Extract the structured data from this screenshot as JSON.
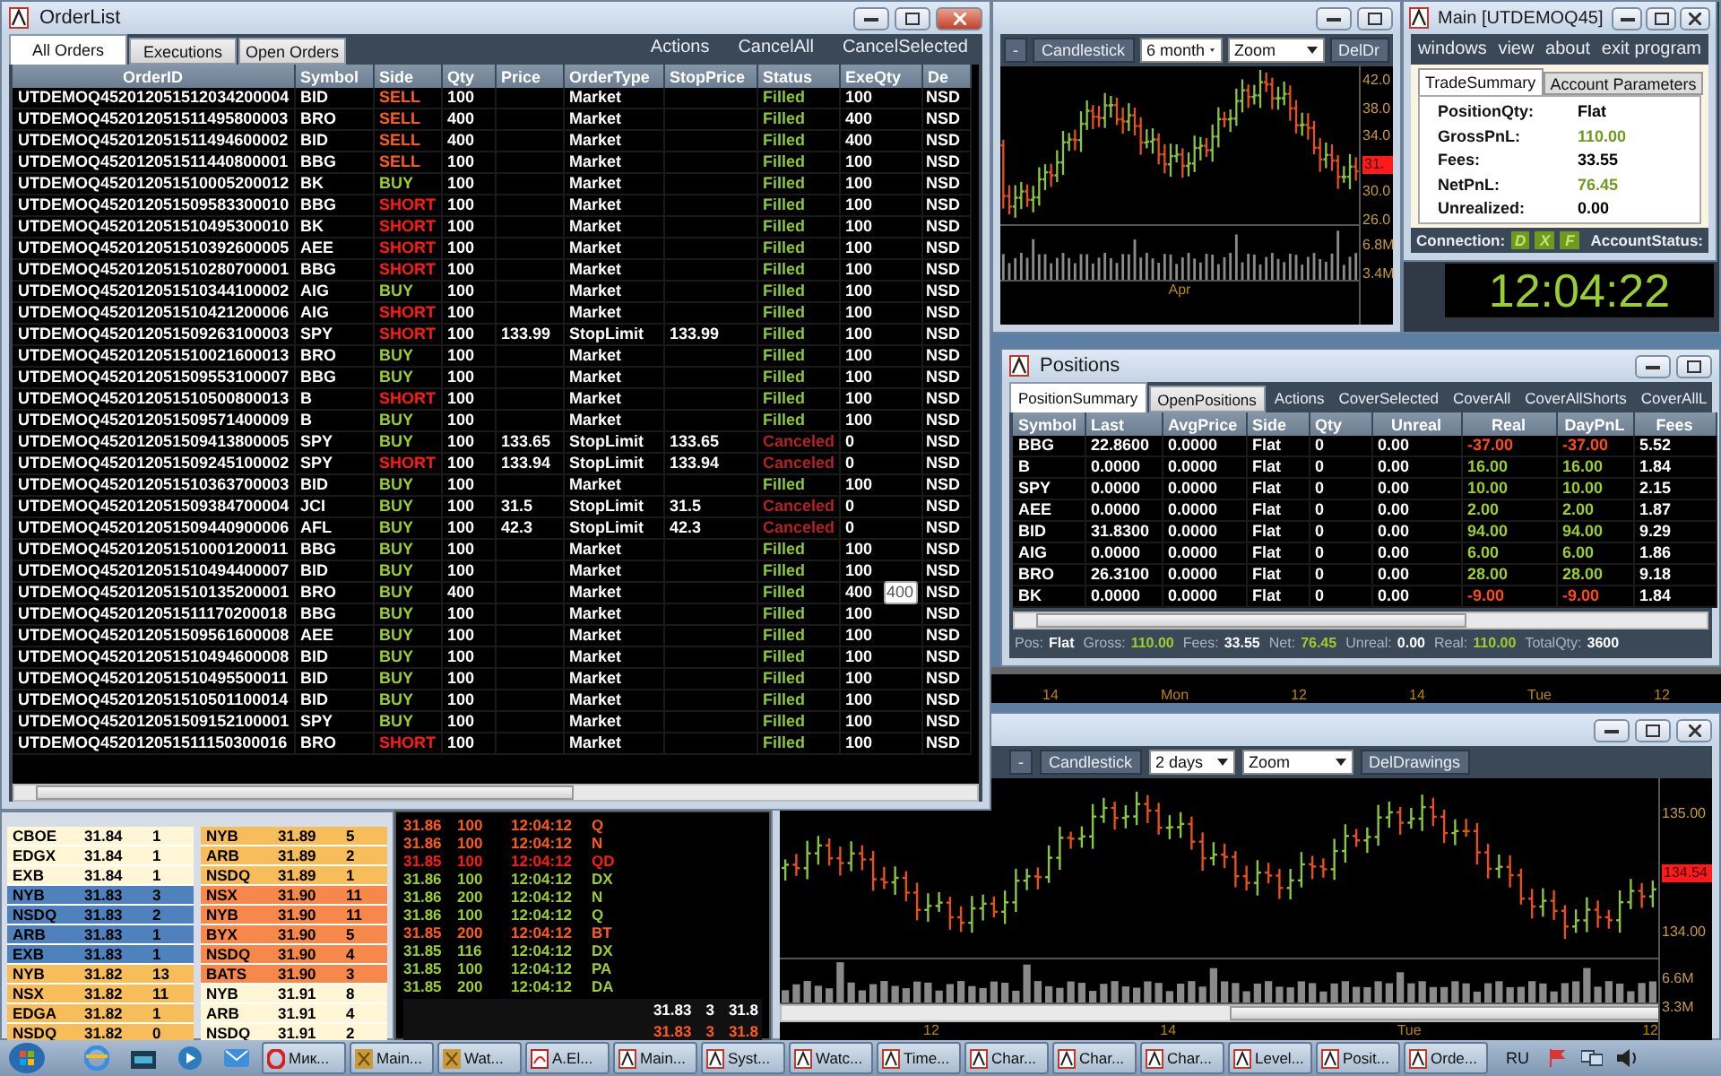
{
  "order_list": {
    "title": "OrderList",
    "tabs": [
      {
        "label": "All Orders",
        "selected": true
      },
      {
        "label": "Executions",
        "selected": false
      },
      {
        "label": "Open Orders",
        "selected": false
      }
    ],
    "actions": [
      "Actions",
      "CancelAll",
      "CancelSelected"
    ],
    "columns": [
      "OrderID",
      "Symbol",
      "Side",
      "Qty",
      "Price",
      "OrderType",
      "StopPrice",
      "Status",
      "ExeQty",
      "De"
    ],
    "rows": [
      {
        "id": "UTDEMOQ452012051512034200004",
        "symbol": "BID",
        "side": {
          "text": "SELL",
          "color": "#ff5a1e"
        },
        "qty": "100",
        "price": "",
        "type": "Market",
        "stop": "",
        "status": {
          "text": "Filled",
          "color": "#8cc63f"
        },
        "exe": "100",
        "dest": "NSD"
      },
      {
        "id": "UTDEMOQ452012051511495800003",
        "symbol": "BRO",
        "side": {
          "text": "SELL",
          "color": "#ff5a1e"
        },
        "qty": "400",
        "price": "",
        "type": "Market",
        "stop": "",
        "status": {
          "text": "Filled",
          "color": "#8cc63f"
        },
        "exe": "400",
        "dest": "NSD"
      },
      {
        "id": "UTDEMOQ452012051511494600002",
        "symbol": "BID",
        "side": {
          "text": "SELL",
          "color": "#ff5a1e"
        },
        "qty": "400",
        "price": "",
        "type": "Market",
        "stop": "",
        "status": {
          "text": "Filled",
          "color": "#8cc63f"
        },
        "exe": "400",
        "dest": "NSD"
      },
      {
        "id": "UTDEMOQ452012051511440800001",
        "symbol": "BBG",
        "side": {
          "text": "SELL",
          "color": "#ff5a1e"
        },
        "qty": "100",
        "price": "",
        "type": "Market",
        "stop": "",
        "status": {
          "text": "Filled",
          "color": "#8cc63f"
        },
        "exe": "100",
        "dest": "NSD"
      },
      {
        "id": "UTDEMOQ452012051510005200012",
        "symbol": "BK",
        "side": {
          "text": "BUY",
          "color": "#9acd32"
        },
        "qty": "100",
        "price": "",
        "type": "Market",
        "stop": "",
        "status": {
          "text": "Filled",
          "color": "#8cc63f"
        },
        "exe": "100",
        "dest": "NSD"
      },
      {
        "id": "UTDEMOQ452012051509583300010",
        "symbol": "BBG",
        "side": {
          "text": "SHORT",
          "color": "#ff1a1a"
        },
        "qty": "100",
        "price": "",
        "type": "Market",
        "stop": "",
        "status": {
          "text": "Filled",
          "color": "#8cc63f"
        },
        "exe": "100",
        "dest": "NSD"
      },
      {
        "id": "UTDEMOQ452012051510495300010",
        "symbol": "BK",
        "side": {
          "text": "SHORT",
          "color": "#ff1a1a"
        },
        "qty": "100",
        "price": "",
        "type": "Market",
        "stop": "",
        "status": {
          "text": "Filled",
          "color": "#8cc63f"
        },
        "exe": "100",
        "dest": "NSD"
      },
      {
        "id": "UTDEMOQ452012051510392600005",
        "symbol": "AEE",
        "side": {
          "text": "SHORT",
          "color": "#ff1a1a"
        },
        "qty": "100",
        "price": "",
        "type": "Market",
        "stop": "",
        "status": {
          "text": "Filled",
          "color": "#8cc63f"
        },
        "exe": "100",
        "dest": "NSD"
      },
      {
        "id": "UTDEMOQ452012051510280700001",
        "symbol": "BBG",
        "side": {
          "text": "SHORT",
          "color": "#ff1a1a"
        },
        "qty": "100",
        "price": "",
        "type": "Market",
        "stop": "",
        "status": {
          "text": "Filled",
          "color": "#8cc63f"
        },
        "exe": "100",
        "dest": "NSD"
      },
      {
        "id": "UTDEMOQ452012051510344100002",
        "symbol": "AIG",
        "side": {
          "text": "BUY",
          "color": "#9acd32"
        },
        "qty": "100",
        "price": "",
        "type": "Market",
        "stop": "",
        "status": {
          "text": "Filled",
          "color": "#8cc63f"
        },
        "exe": "100",
        "dest": "NSD"
      },
      {
        "id": "UTDEMOQ452012051510421200006",
        "symbol": "AIG",
        "side": {
          "text": "SHORT",
          "color": "#ff1a1a"
        },
        "qty": "100",
        "price": "",
        "type": "Market",
        "stop": "",
        "status": {
          "text": "Filled",
          "color": "#8cc63f"
        },
        "exe": "100",
        "dest": "NSD"
      },
      {
        "id": "UTDEMOQ452012051509263100003",
        "symbol": "SPY",
        "side": {
          "text": "SHORT",
          "color": "#ff1a1a"
        },
        "qty": "100",
        "price": "133.99",
        "type": "StopLimit",
        "stop": "133.99",
        "status": {
          "text": "Filled",
          "color": "#8cc63f"
        },
        "exe": "100",
        "dest": "NSD"
      },
      {
        "id": "UTDEMOQ452012051510021600013",
        "symbol": "BRO",
        "side": {
          "text": "BUY",
          "color": "#9acd32"
        },
        "qty": "100",
        "price": "",
        "type": "Market",
        "stop": "",
        "status": {
          "text": "Filled",
          "color": "#8cc63f"
        },
        "exe": "100",
        "dest": "NSD"
      },
      {
        "id": "UTDEMOQ452012051509553100007",
        "symbol": "BBG",
        "side": {
          "text": "BUY",
          "color": "#9acd32"
        },
        "qty": "100",
        "price": "",
        "type": "Market",
        "stop": "",
        "status": {
          "text": "Filled",
          "color": "#8cc63f"
        },
        "exe": "100",
        "dest": "NSD"
      },
      {
        "id": "UTDEMOQ452012051510500800013",
        "symbol": "B",
        "side": {
          "text": "SHORT",
          "color": "#ff1a1a"
        },
        "qty": "100",
        "price": "",
        "type": "Market",
        "stop": "",
        "status": {
          "text": "Filled",
          "color": "#8cc63f"
        },
        "exe": "100",
        "dest": "NSD"
      },
      {
        "id": "UTDEMOQ452012051509571400009",
        "symbol": "B",
        "side": {
          "text": "BUY",
          "color": "#9acd32"
        },
        "qty": "100",
        "price": "",
        "type": "Market",
        "stop": "",
        "status": {
          "text": "Filled",
          "color": "#8cc63f"
        },
        "exe": "100",
        "dest": "NSD"
      },
      {
        "id": "UTDEMOQ452012051509413800005",
        "symbol": "SPY",
        "side": {
          "text": "BUY",
          "color": "#9acd32"
        },
        "qty": "100",
        "price": "133.65",
        "type": "StopLimit",
        "stop": "133.65",
        "status": {
          "text": "Canceled",
          "color": "#b22222"
        },
        "exe": "0",
        "dest": "NSD"
      },
      {
        "id": "UTDEMOQ452012051509245100002",
        "symbol": "SPY",
        "side": {
          "text": "SHORT",
          "color": "#ff1a1a"
        },
        "qty": "100",
        "price": "133.94",
        "type": "StopLimit",
        "stop": "133.94",
        "status": {
          "text": "Canceled",
          "color": "#b22222"
        },
        "exe": "0",
        "dest": "NSD"
      },
      {
        "id": "UTDEMOQ452012051510363700003",
        "symbol": "BID",
        "side": {
          "text": "BUY",
          "color": "#9acd32"
        },
        "qty": "100",
        "price": "",
        "type": "Market",
        "stop": "",
        "status": {
          "text": "Filled",
          "color": "#8cc63f"
        },
        "exe": "100",
        "dest": "NSD"
      },
      {
        "id": "UTDEMOQ452012051509384700004",
        "symbol": "JCI",
        "side": {
          "text": "BUY",
          "color": "#9acd32"
        },
        "qty": "100",
        "price": "31.5",
        "type": "StopLimit",
        "stop": "31.5",
        "status": {
          "text": "Canceled",
          "color": "#b22222"
        },
        "exe": "0",
        "dest": "NSD"
      },
      {
        "id": "UTDEMOQ452012051509440900006",
        "symbol": "AFL",
        "side": {
          "text": "BUY",
          "color": "#9acd32"
        },
        "qty": "100",
        "price": "42.3",
        "type": "StopLimit",
        "stop": "42.3",
        "status": {
          "text": "Canceled",
          "color": "#b22222"
        },
        "exe": "0",
        "dest": "NSD"
      },
      {
        "id": "UTDEMOQ452012051510001200011",
        "symbol": "BBG",
        "side": {
          "text": "BUY",
          "color": "#9acd32"
        },
        "qty": "100",
        "price": "",
        "type": "Market",
        "stop": "",
        "status": {
          "text": "Filled",
          "color": "#8cc63f"
        },
        "exe": "100",
        "dest": "NSD"
      },
      {
        "id": "UTDEMOQ452012051510494400007",
        "symbol": "BID",
        "side": {
          "text": "BUY",
          "color": "#9acd32"
        },
        "qty": "100",
        "price": "",
        "type": "Market",
        "stop": "",
        "status": {
          "text": "Filled",
          "color": "#8cc63f"
        },
        "exe": "100",
        "dest": "NSD"
      },
      {
        "id": "UTDEMOQ452012051510135200001",
        "symbol": "BRO",
        "side": {
          "text": "BUY",
          "color": "#9acd32"
        },
        "qty": "400",
        "price": "",
        "type": "Market",
        "stop": "",
        "status": {
          "text": "Filled",
          "color": "#8cc63f"
        },
        "exe": "400",
        "dest": "NSD",
        "tooltip": "400"
      },
      {
        "id": "UTDEMOQ452012051511170200018",
        "symbol": "BBG",
        "side": {
          "text": "BUY",
          "color": "#9acd32"
        },
        "qty": "100",
        "price": "",
        "type": "Market",
        "stop": "",
        "status": {
          "text": "Filled",
          "color": "#8cc63f"
        },
        "exe": "100",
        "dest": "NSD"
      },
      {
        "id": "UTDEMOQ452012051509561600008",
        "symbol": "AEE",
        "side": {
          "text": "BUY",
          "color": "#9acd32"
        },
        "qty": "100",
        "price": "",
        "type": "Market",
        "stop": "",
        "status": {
          "text": "Filled",
          "color": "#8cc63f"
        },
        "exe": "100",
        "dest": "NSD"
      },
      {
        "id": "UTDEMOQ452012051510494600008",
        "symbol": "BID",
        "side": {
          "text": "BUY",
          "color": "#9acd32"
        },
        "qty": "100",
        "price": "",
        "type": "Market",
        "stop": "",
        "status": {
          "text": "Filled",
          "color": "#8cc63f"
        },
        "exe": "100",
        "dest": "NSD"
      },
      {
        "id": "UTDEMOQ452012051510495500011",
        "symbol": "BID",
        "side": {
          "text": "BUY",
          "color": "#9acd32"
        },
        "qty": "100",
        "price": "",
        "type": "Market",
        "stop": "",
        "status": {
          "text": "Filled",
          "color": "#8cc63f"
        },
        "exe": "100",
        "dest": "NSD"
      },
      {
        "id": "UTDEMOQ452012051510501100014",
        "symbol": "BID",
        "side": {
          "text": "BUY",
          "color": "#9acd32"
        },
        "qty": "100",
        "price": "",
        "type": "Market",
        "stop": "",
        "status": {
          "text": "Filled",
          "color": "#8cc63f"
        },
        "exe": "100",
        "dest": "NSD"
      },
      {
        "id": "UTDEMOQ452012051509152100001",
        "symbol": "SPY",
        "side": {
          "text": "BUY",
          "color": "#9acd32"
        },
        "qty": "100",
        "price": "",
        "type": "Market",
        "stop": "",
        "status": {
          "text": "Filled",
          "color": "#8cc63f"
        },
        "exe": "100",
        "dest": "NSD"
      },
      {
        "id": "UTDEMOQ452012051511150300016",
        "symbol": "BRO",
        "side": {
          "text": "SHORT",
          "color": "#ff1a1a"
        },
        "qty": "100",
        "price": "",
        "type": "Market",
        "stop": "",
        "status": {
          "text": "Filled",
          "color": "#8cc63f"
        },
        "exe": "100",
        "dest": "NSD"
      }
    ]
  },
  "chart_top": {
    "toolbar": {
      "buttons": [
        "-",
        "Candlestick"
      ],
      "period": "6 month",
      "zoom": "Zoom",
      "last_button": "DelDr"
    },
    "price_labels": [
      {
        "text": "42.0",
        "kind": "tick"
      },
      {
        "text": "38.0",
        "kind": "tick"
      },
      {
        "text": "34.0",
        "kind": "tick"
      },
      {
        "text": "31.",
        "kind": "last"
      },
      {
        "text": "30.0",
        "kind": "tick"
      },
      {
        "text": "26.0",
        "kind": "tick"
      }
    ],
    "volume_labels": [
      "6.8M",
      "3.4M"
    ],
    "time_labels": [
      "Apr"
    ]
  },
  "main": {
    "title": "Main [UTDEMOQ45]",
    "menu": [
      "windows",
      "view",
      "about",
      "exit program"
    ],
    "tabs": [
      {
        "label": "TradeSummary",
        "selected": true
      },
      {
        "label": "Account Parameters",
        "selected": false
      }
    ],
    "fields": [
      {
        "label": "PositionQty:",
        "value": "Flat",
        "color": "#000000"
      },
      {
        "label": "GrossPnL:",
        "value": "110.00",
        "color": "#6e9b1e"
      },
      {
        "label": "Fees:",
        "value": "33.55",
        "color": "#000000"
      },
      {
        "label": "NetPnL:",
        "value": "76.45",
        "color": "#6e9b1e"
      },
      {
        "label": "Unrealized:",
        "value": "0.00",
        "color": "#000000"
      }
    ],
    "connection_label": "Connection:",
    "connections": [
      "D",
      "X",
      "F"
    ],
    "account_status_label": "AccountStatus:"
  },
  "clock": "12:04:22",
  "positions": {
    "title": "Positions",
    "tabs": [
      {
        "label": "PositionSummary",
        "selected": true
      },
      {
        "label": "OpenPositions",
        "selected": false
      }
    ],
    "actions": [
      "Actions",
      "CoverSelected",
      "CoverAll",
      "CoverAllShorts",
      "CoverAllL"
    ],
    "columns": [
      "Symbol",
      "Last",
      "AvgPrice",
      "Side",
      "Qty",
      "Unreal",
      "Real",
      "DayPnL",
      "Fees"
    ],
    "rows": [
      {
        "symbol": "BBG",
        "last": "22.8600",
        "avg": "0.0000",
        "side": "Flat",
        "qty": "0",
        "unreal": "0.00",
        "real": "-37.00",
        "day": "-37.00",
        "fees": "5.52",
        "color": "#ff4a1a"
      },
      {
        "symbol": "B",
        "last": "0.0000",
        "avg": "0.0000",
        "side": "Flat",
        "qty": "0",
        "unreal": "0.00",
        "real": "16.00",
        "day": "16.00",
        "fees": "1.84",
        "color": "#9acd32"
      },
      {
        "symbol": "SPY",
        "last": "0.0000",
        "avg": "0.0000",
        "side": "Flat",
        "qty": "0",
        "unreal": "0.00",
        "real": "10.00",
        "day": "10.00",
        "fees": "2.15",
        "color": "#9acd32"
      },
      {
        "symbol": "AEE",
        "last": "0.0000",
        "avg": "0.0000",
        "side": "Flat",
        "qty": "0",
        "unreal": "0.00",
        "real": "2.00",
        "day": "2.00",
        "fees": "1.87",
        "color": "#9acd32"
      },
      {
        "symbol": "BID",
        "last": "31.8300",
        "avg": "0.0000",
        "side": "Flat",
        "qty": "0",
        "unreal": "0.00",
        "real": "94.00",
        "day": "94.00",
        "fees": "9.29",
        "color": "#9acd32"
      },
      {
        "symbol": "AIG",
        "last": "0.0000",
        "avg": "0.0000",
        "side": "Flat",
        "qty": "0",
        "unreal": "0.00",
        "real": "6.00",
        "day": "6.00",
        "fees": "1.86",
        "color": "#9acd32"
      },
      {
        "symbol": "BRO",
        "last": "26.3100",
        "avg": "0.0000",
        "side": "Flat",
        "qty": "0",
        "unreal": "0.00",
        "real": "28.00",
        "day": "28.00",
        "fees": "9.18",
        "color": "#9acd32"
      },
      {
        "symbol": "BK",
        "last": "0.0000",
        "avg": "0.0000",
        "side": "Flat",
        "qty": "0",
        "unreal": "0.00",
        "real": "-9.00",
        "day": "-9.00",
        "fees": "1.84",
        "color": "#ff4a1a"
      }
    ],
    "summary": [
      {
        "label": "Pos:",
        "value": "Flat",
        "color": "#ffffff"
      },
      {
        "label": "Gross:",
        "value": "110.00",
        "color": "#9acd32"
      },
      {
        "label": "Fees:",
        "value": "33.55",
        "color": "#ffffff"
      },
      {
        "label": "Net:",
        "value": "76.45",
        "color": "#9acd32"
      },
      {
        "label": "Unreal:",
        "value": "0.00",
        "color": "#ffffff"
      },
      {
        "label": "Real:",
        "value": "110.00",
        "color": "#9acd32"
      },
      {
        "label": "TotalQty:",
        "value": "3600",
        "color": "#ffffff"
      }
    ]
  },
  "time_strip": [
    "14",
    "Mon",
    "12",
    "14",
    "Tue",
    "12"
  ],
  "chart_bottom": {
    "toolbar": {
      "buttons": [
        "-",
        "Candlestick"
      ],
      "period": "2 days",
      "zoom": "Zoom",
      "last_button": "DelDrawings"
    },
    "price_labels": [
      {
        "text": "135.00",
        "kind": "tick"
      },
      {
        "text": "134.54",
        "kind": "last"
      },
      {
        "text": "134.00",
        "kind": "tick"
      }
    ],
    "volume_labels": [
      "6.6M",
      "3.3M"
    ],
    "time_labels": [
      "12",
      "14",
      "Tue",
      "12"
    ]
  },
  "level2": {
    "bids": [
      {
        "exchange": "CBOE",
        "price": "31.84",
        "size": "1",
        "color": "#fff6d5"
      },
      {
        "exchange": "EDGX",
        "price": "31.84",
        "size": "1",
        "color": "#fff6d5"
      },
      {
        "exchange": "EXB",
        "price": "31.84",
        "size": "1",
        "color": "#fff6d5"
      },
      {
        "exchange": "NYB",
        "price": "31.83",
        "size": "3",
        "color": "#4f81bd"
      },
      {
        "exchange": "NSDQ",
        "price": "31.83",
        "size": "2",
        "color": "#4f81bd"
      },
      {
        "exchange": "ARB",
        "price": "31.83",
        "size": "1",
        "color": "#4f81bd"
      },
      {
        "exchange": "EXB",
        "price": "31.83",
        "size": "1",
        "color": "#4f81bd"
      },
      {
        "exchange": "NYB",
        "price": "31.82",
        "size": "13",
        "color": "#f6bd5a"
      },
      {
        "exchange": "NSX",
        "price": "31.82",
        "size": "11",
        "color": "#f6bd5a"
      },
      {
        "exchange": "EDGA",
        "price": "31.82",
        "size": "1",
        "color": "#f6bd5a"
      },
      {
        "exchange": "NSDQ",
        "price": "31.82",
        "size": "0",
        "color": "#f6bd5a"
      }
    ],
    "asks": [
      {
        "exchange": "NYB",
        "price": "31.89",
        "size": "5",
        "color": "#f6bd5a"
      },
      {
        "exchange": "ARB",
        "price": "31.89",
        "size": "2",
        "color": "#f6bd5a"
      },
      {
        "exchange": "NSDQ",
        "price": "31.89",
        "size": "1",
        "color": "#f6bd5a"
      },
      {
        "exchange": "NSX",
        "price": "31.90",
        "size": "11",
        "color": "#f5884a"
      },
      {
        "exchange": "NYB",
        "price": "31.90",
        "size": "11",
        "color": "#f5884a"
      },
      {
        "exchange": "BYX",
        "price": "31.90",
        "size": "5",
        "color": "#f5884a"
      },
      {
        "exchange": "NSDQ",
        "price": "31.90",
        "size": "4",
        "color": "#f5884a"
      },
      {
        "exchange": "BATS",
        "price": "31.90",
        "size": "3",
        "color": "#f5884a"
      },
      {
        "exchange": "NYB",
        "price": "31.91",
        "size": "8",
        "color": "#fff6d5"
      },
      {
        "exchange": "ARB",
        "price": "31.91",
        "size": "4",
        "color": "#fff6d5"
      },
      {
        "exchange": "NSDQ",
        "price": "31.91",
        "size": "2",
        "color": "#fff6d5"
      }
    ]
  },
  "time_and_sales": {
    "trades": [
      {
        "price": "31.86",
        "size": "100",
        "time": "12:04:12",
        "exchange": "Q",
        "color": "#ff5a1e"
      },
      {
        "price": "31.86",
        "size": "100",
        "time": "12:04:12",
        "exchange": "N",
        "color": "#ff5a1e"
      },
      {
        "price": "31.85",
        "size": "100",
        "time": "12:04:12",
        "exchange": "QD",
        "color": "#ff1a1a"
      },
      {
        "price": "31.86",
        "size": "100",
        "time": "12:04:12",
        "exchange": "DX",
        "color": "#9acd32"
      },
      {
        "price": "31.86",
        "size": "200",
        "time": "12:04:12",
        "exchange": "N",
        "color": "#9acd32"
      },
      {
        "price": "31.86",
        "size": "100",
        "time": "12:04:12",
        "exchange": "Q",
        "color": "#9acd32"
      },
      {
        "price": "31.85",
        "size": "200",
        "time": "12:04:12",
        "exchange": "BT",
        "color": "#ff5a1e"
      },
      {
        "price": "31.85",
        "size": "116",
        "time": "12:04:12",
        "exchange": "DX",
        "color": "#9acd32"
      },
      {
        "price": "31.85",
        "size": "100",
        "time": "12:04:12",
        "exchange": "PA",
        "color": "#9acd32"
      },
      {
        "price": "31.85",
        "size": "200",
        "time": "12:04:12",
        "exchange": "DA",
        "color": "#9acd32"
      }
    ],
    "quotes": [
      {
        "price": "31.83",
        "size": "3",
        "other": "31.8",
        "color": "#ffffff"
      },
      {
        "price": "31.83",
        "size": "3",
        "other": "31.8",
        "color": "#ff5a1e"
      }
    ]
  },
  "taskbar": {
    "items": [
      {
        "label": "Мик...",
        "kind": "browser"
      },
      {
        "label": "Main...",
        "kind": "gold"
      },
      {
        "label": "Wat...",
        "kind": "gold"
      },
      {
        "label": "A.El...",
        "kind": "pdf"
      },
      {
        "label": "Main...",
        "kind": "app"
      },
      {
        "label": "Syst...",
        "kind": "app"
      },
      {
        "label": "Watc...",
        "kind": "app"
      },
      {
        "label": "Time...",
        "kind": "app"
      },
      {
        "label": "Char...",
        "kind": "app"
      },
      {
        "label": "Char...",
        "kind": "app"
      },
      {
        "label": "Char...",
        "kind": "app"
      },
      {
        "label": "Level...",
        "kind": "app"
      },
      {
        "label": "Posit...",
        "kind": "app"
      },
      {
        "label": "Orde...",
        "kind": "app"
      }
    ],
    "language": "RU"
  }
}
